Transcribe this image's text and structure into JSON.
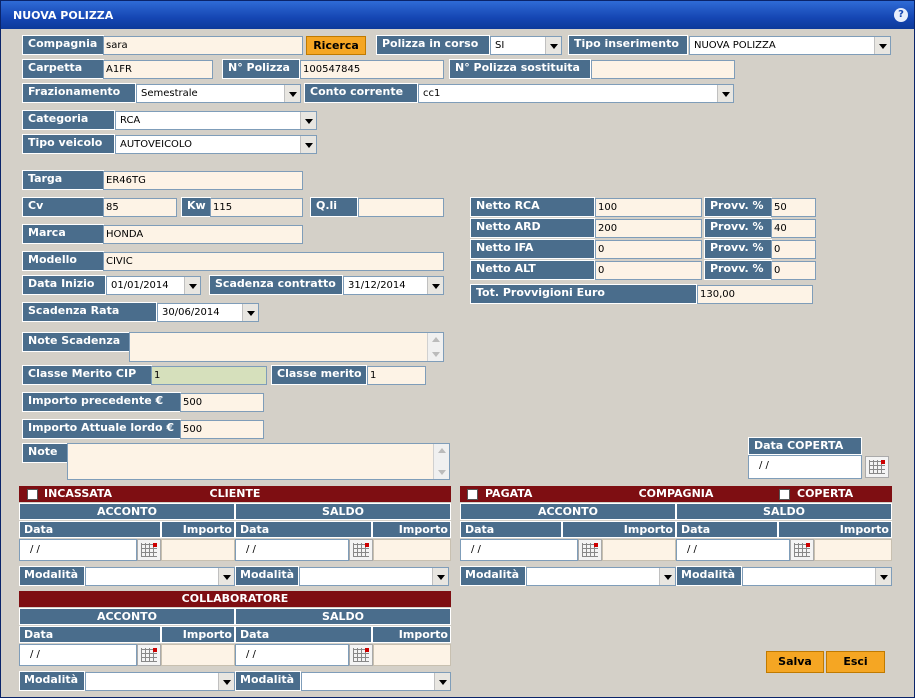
{
  "window": {
    "title": "NUOVA POLIZZA",
    "help": "?"
  },
  "compagnia": {
    "label": "Compagnia",
    "value": "sara",
    "search_button": "Ricerca"
  },
  "polizza_in_corso": {
    "label": "Polizza in corso",
    "value": "SI"
  },
  "tipo_inserimento": {
    "label": "Tipo inserimento",
    "value": "NUOVA POLIZZA"
  },
  "carpetta": {
    "label": "Carpetta",
    "value": "A1FR"
  },
  "n_polizza": {
    "label": "N° Polizza",
    "value": "100547845"
  },
  "n_polizza_sost": {
    "label": "N° Polizza sostituita",
    "value": ""
  },
  "frazionamento": {
    "label": "Frazionamento",
    "value": "Semestrale"
  },
  "conto_corrente": {
    "label": "Conto corrente",
    "value": "cc1"
  },
  "categoria": {
    "label": "Categoria",
    "value": "RCA"
  },
  "tipo_veicolo": {
    "label": "Tipo veicolo",
    "value": "AUTOVEICOLO"
  },
  "targa": {
    "label": "Targa",
    "value": "ER46TG"
  },
  "cv": {
    "label": "Cv",
    "value": "85"
  },
  "kw": {
    "label": "Kw",
    "value": "115"
  },
  "qli": {
    "label": "Q.li",
    "value": ""
  },
  "marca": {
    "label": "Marca",
    "value": "HONDA"
  },
  "modello": {
    "label": "Modello",
    "value": "CIVIC"
  },
  "data_inizio": {
    "label": "Data Inizio",
    "value": "01/01/2014"
  },
  "scadenza_contratto": {
    "label": "Scadenza contratto",
    "value": "31/12/2014"
  },
  "scadenza_rata": {
    "label": "Scadenza Rata",
    "value": "30/06/2014"
  },
  "note_scadenza": {
    "label": "Note Scadenza",
    "value": ""
  },
  "classe_merito_cip": {
    "label": "Classe Merito CIP",
    "value": "1"
  },
  "classe_merito": {
    "label": "Classe merito",
    "value": "1"
  },
  "importo_precedente": {
    "label": "Importo precedente €",
    "value": "500"
  },
  "importo_attuale": {
    "label": "Importo Attuale lordo €",
    "value": "500"
  },
  "note": {
    "label": "Note",
    "value": ""
  },
  "netti": [
    {
      "label": "Netto RCA",
      "value": "100",
      "provv_label": "Provv. %",
      "provv": "50"
    },
    {
      "label": "Netto ARD",
      "value": "200",
      "provv_label": "Provv. %",
      "provv": "40"
    },
    {
      "label": "Netto IFA",
      "value": "0",
      "provv_label": "Provv. %",
      "provv": "0"
    },
    {
      "label": "Netto ALT",
      "value": "0",
      "provv_label": "Provv. %",
      "provv": "0"
    }
  ],
  "tot_provvigioni": {
    "label": "Tot. Provvigioni Euro",
    "value": "130,00"
  },
  "data_coperta": {
    "label": "Data COPERTA",
    "value": " /  /"
  },
  "cliente": {
    "title": "CLIENTE",
    "check_label": "INCASSATA",
    "acconto": "ACCONTO",
    "saldo": "SALDO",
    "data": "Data",
    "importo": "Importo",
    "modalita": "Modalità",
    "acconto_date": " /  /",
    "saldo_date": " /  /"
  },
  "compagnia_pay": {
    "title": "COMPAGNIA",
    "check_label": "PAGATA",
    "check2_label": "COPERTA",
    "acconto": "ACCONTO",
    "saldo": "SALDO",
    "data": "Data",
    "importo": "Importo",
    "modalita": "Modalità",
    "acconto_date": " /  /",
    "saldo_date": " /  /"
  },
  "collaboratore": {
    "title": "COLLABORATORE",
    "acconto": "ACCONTO",
    "saldo": "SALDO",
    "data": "Data",
    "importo": "Importo",
    "modalita": "Modalità",
    "acconto_date": " /  /",
    "saldo_date": " /  /"
  },
  "buttons": {
    "save": "Salva",
    "exit": "Esci"
  }
}
